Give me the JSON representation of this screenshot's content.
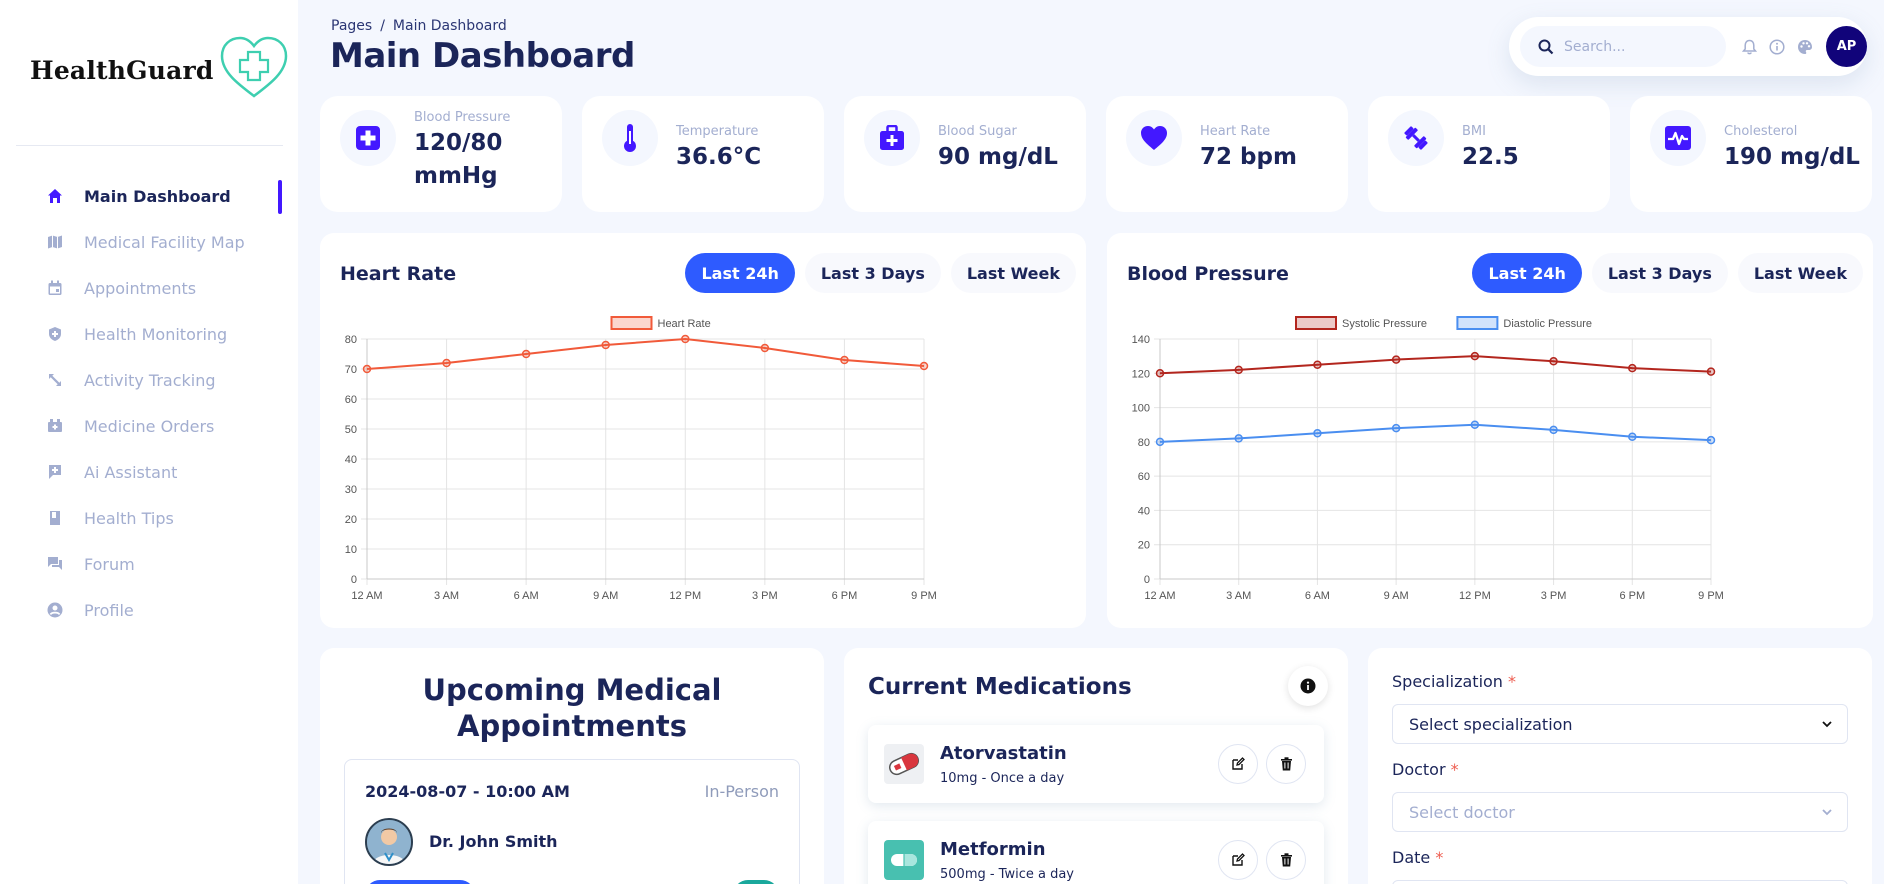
{
  "app": {
    "name": "HealthGuard"
  },
  "sidebar": {
    "items": [
      {
        "label": "Main Dashboard",
        "icon": "home-icon",
        "active": true
      },
      {
        "label": "Medical Facility Map",
        "icon": "map-icon"
      },
      {
        "label": "Appointments",
        "icon": "calendar-icon"
      },
      {
        "label": "Health Monitoring",
        "icon": "shield-icon"
      },
      {
        "label": "Activity Tracking",
        "icon": "arrows-icon"
      },
      {
        "label": "Medicine Orders",
        "icon": "medicine-icon"
      },
      {
        "label": "Ai Assistant",
        "icon": "chat-plus-icon"
      },
      {
        "label": "Health Tips",
        "icon": "book-icon"
      },
      {
        "label": "Forum",
        "icon": "forum-icon"
      },
      {
        "label": "Profile",
        "icon": "user-icon"
      }
    ]
  },
  "header": {
    "breadcrumb": [
      "Pages",
      "/",
      "Main Dashboard"
    ],
    "title": "Main Dashboard",
    "search_placeholder": "Search...",
    "avatar_initials": "AP"
  },
  "stats": [
    {
      "label": "Blood Pressure",
      "value_line1": "120/80",
      "value_line2": "mmHg",
      "icon": "medical-cross-icon"
    },
    {
      "label": "Temperature",
      "value": "36.6°C",
      "icon": "thermometer-icon"
    },
    {
      "label": "Blood Sugar",
      "value": "90 mg/dL",
      "icon": "medkit-icon"
    },
    {
      "label": "Heart Rate",
      "value": "72 bpm",
      "icon": "heart-icon"
    },
    {
      "label": "BMI",
      "value": "22.5",
      "icon": "dumbbell-icon"
    },
    {
      "label": "Cholesterol",
      "value": "190 mg/dL",
      "icon": "heart-monitor-icon"
    }
  ],
  "range_options": [
    "Last 24h",
    "Last 3 Days",
    "Last Week"
  ],
  "chart_data": [
    {
      "type": "line",
      "title": "Heart Rate",
      "categories": [
        "12 AM",
        "3 AM",
        "6 AM",
        "9 AM",
        "12 PM",
        "3 PM",
        "6 PM",
        "9 PM"
      ],
      "series": [
        {
          "name": "Heart Rate",
          "values": [
            70,
            72,
            75,
            78,
            80,
            77,
            73,
            71
          ],
          "color": "#f15a3a"
        }
      ],
      "ylim": [
        0,
        80
      ],
      "yticks": [
        0,
        10,
        20,
        30,
        40,
        50,
        60,
        70,
        80
      ],
      "grid": true,
      "legend": "top"
    },
    {
      "type": "line",
      "title": "Blood Pressure",
      "categories": [
        "12 AM",
        "3 AM",
        "6 AM",
        "9 AM",
        "12 PM",
        "3 PM",
        "6 PM",
        "9 PM"
      ],
      "series": [
        {
          "name": "Systolic Pressure",
          "values": [
            120,
            122,
            125,
            128,
            130,
            127,
            123,
            121
          ],
          "color": "#b3261e"
        },
        {
          "name": "Diastolic Pressure",
          "values": [
            80,
            82,
            85,
            88,
            90,
            87,
            83,
            81
          ],
          "color": "#4a8ef0"
        }
      ],
      "ylim": [
        0,
        140
      ],
      "yticks": [
        0,
        20,
        40,
        60,
        80,
        100,
        120,
        140
      ],
      "grid": true,
      "legend": "top"
    }
  ],
  "appointments": {
    "title_line1": "Upcoming Medical",
    "title_line2": "Appointments",
    "items": [
      {
        "datetime": "2024-08-07 - 10:00 AM",
        "type": "In-Person",
        "doctor": "Dr. John Smith"
      }
    ]
  },
  "medications": {
    "title": "Current Medications",
    "items": [
      {
        "name": "Atorvastatin",
        "dose": "10mg - Once a day"
      },
      {
        "name": "Metformin",
        "dose": "500mg - Twice a day"
      }
    ]
  },
  "booking_form": {
    "specialization_label": "Specialization",
    "specialization_value": "Select specialization",
    "doctor_label": "Doctor",
    "doctor_value": "Select doctor",
    "date_label": "Date",
    "required_mark": "*"
  },
  "colors": {
    "accent": "#4318ff",
    "primary_button": "#2e5bff",
    "text": "#1b2559",
    "muted": "#a3aed0",
    "logo": "#3ecfb0"
  }
}
